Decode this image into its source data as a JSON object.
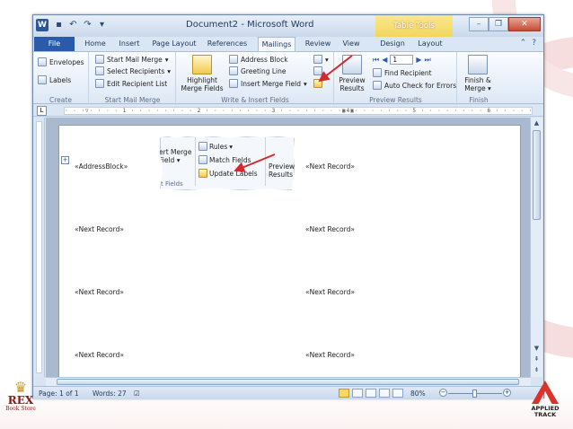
{
  "window": {
    "title": "Document2 - Microsoft Word",
    "contextual_tab_group": "Table Tools",
    "app_icon_letter": "W",
    "quick_access": [
      "save-icon",
      "undo-icon",
      "redo-icon",
      "customize-icon"
    ],
    "controls": [
      "minimize-icon",
      "restore-icon",
      "close-icon"
    ]
  },
  "tabs": [
    {
      "label": "File"
    },
    {
      "label": "Home"
    },
    {
      "label": "Insert"
    },
    {
      "label": "Page Layout"
    },
    {
      "label": "References"
    },
    {
      "label": "Mailings",
      "active": true
    },
    {
      "label": "Review"
    },
    {
      "label": "View"
    },
    {
      "label": "Design"
    },
    {
      "label": "Layout"
    }
  ],
  "ribbon": {
    "create": {
      "label": "Create",
      "envelopes": "Envelopes",
      "labels": "Labels"
    },
    "start_mail_merge": {
      "label": "Start Mail Merge",
      "start_mail_merge": "Start Mail Merge",
      "select_recipients": "Select Recipients",
      "edit_recipient_list": "Edit Recipient List"
    },
    "write_insert": {
      "label": "Write & Insert Fields",
      "highlight_merge_fields_1": "Highlight",
      "highlight_merge_fields_2": "Merge Fields",
      "address_block": "Address Block",
      "greeting_line": "Greeting Line",
      "insert_merge_field": "Insert Merge Field"
    },
    "preview": {
      "label": "Preview Results",
      "preview_results_1": "Preview",
      "preview_results_2": "Results",
      "record_number": "1",
      "find_recipient": "Find Recipient",
      "auto_check": "Auto Check for Errors"
    },
    "finish": {
      "label": "Finish",
      "finish_merge_1": "Finish &",
      "finish_merge_2": "Merge"
    }
  },
  "ruler": {
    "tab_selector": "L",
    "text": "· · ·▽· · · · 1 · · · · · · · · 2 · · · · · · · · 3 · · · · · · · ·▣4▣· · · · · · · 5 · · · · · · · · 6 · · · · · · · · 7 · · · · · · · 8"
  },
  "document": {
    "fields": [
      "«AddressBlock»",
      "«Next Record»",
      "«Next Record»",
      "«Next Record»",
      "«Next Record»",
      "«Next Record»",
      "«Next Record»",
      "«Next Record»"
    ]
  },
  "callout": {
    "rules": "Rules",
    "match_fields": "Match Fields",
    "update_labels": "Update Labels",
    "insert_merge_1": "ert Merge",
    "insert_merge_2": "Field",
    "preview_1": "Preview",
    "preview_2": "Results",
    "group_fragment": "t Fields"
  },
  "status": {
    "page": "Page: 1 of 1",
    "words": "Words: 27",
    "zoom": "80%",
    "zoom_level_percent": 80
  },
  "logos": {
    "left_brand": "REX",
    "left_sub": "Book Store",
    "right_brand": "APPLIED TRACK"
  },
  "colors": {
    "file_tab": "#2a5bab",
    "table_tools": "#f2d560",
    "arrow": "#d22a2a",
    "close_button": "#c64c34"
  }
}
